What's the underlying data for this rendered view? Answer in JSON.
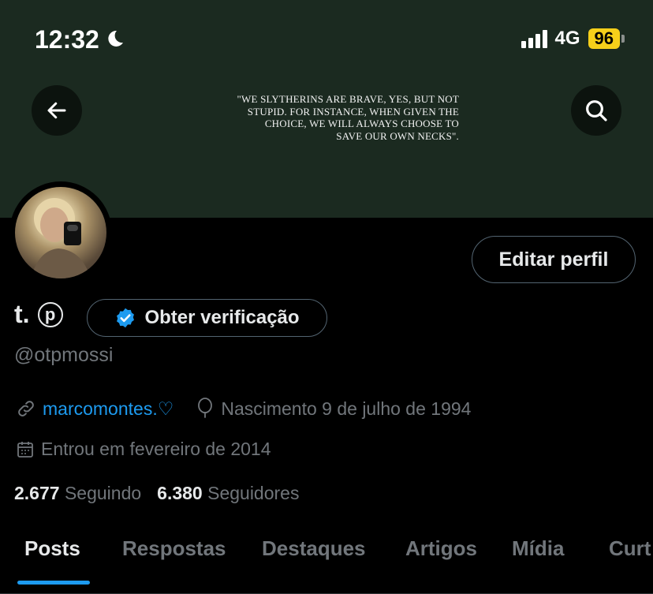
{
  "status_bar": {
    "time": "12:32",
    "network": "4G",
    "battery": "96"
  },
  "banner": {
    "quote": "\"WE SLYTHERINS ARE BRAVE, YES, BUT NOT STUPID. FOR INSTANCE, WHEN GIVEN THE CHOICE, WE WILL ALWAYS CHOOSE TO SAVE OUR OWN NECKS\"."
  },
  "profile": {
    "edit_label": "Editar perfil",
    "display_name": "t.",
    "name_badge": "p",
    "verify_label": "Obter verificação",
    "handle": "@otpmossi",
    "website": "marcomontes.♡",
    "birth": "Nascimento 9 de julho de 1994",
    "joined": "Entrou em fevereiro de 2014",
    "following_count": "2.677",
    "following_label": "Seguindo",
    "followers_count": "6.380",
    "followers_label": "Seguidores"
  },
  "tabs": [
    {
      "label": "Posts",
      "active": true
    },
    {
      "label": "Respostas",
      "active": false
    },
    {
      "label": "Destaques",
      "active": false
    },
    {
      "label": "Artigos",
      "active": false
    },
    {
      "label": "Mídia",
      "active": false
    },
    {
      "label": "Curt",
      "active": false
    }
  ],
  "colors": {
    "accent": "#1d9bf0",
    "banner": "#1b2a20",
    "battery": "#f6cf1a",
    "muted": "#71767b"
  }
}
